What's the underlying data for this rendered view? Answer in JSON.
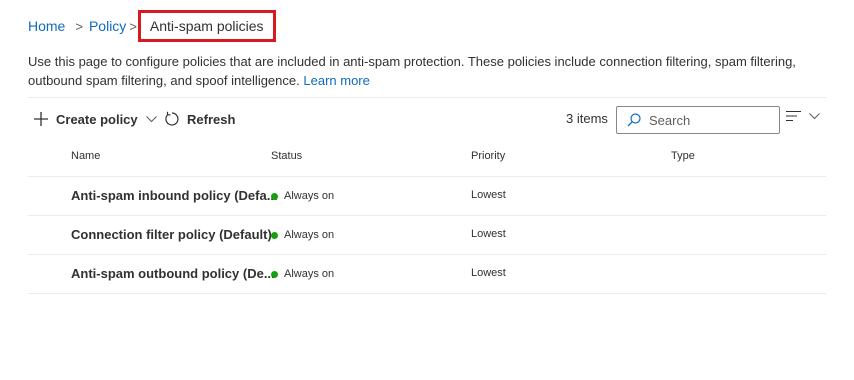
{
  "breadcrumb": {
    "home": "Home",
    "policy": "Policy",
    "current": "Anti-spam policies",
    "separator": ">"
  },
  "description": {
    "text": "Use this page to configure policies that are included in anti-spam protection. These policies include connection filtering, spam filtering, outbound spam filtering, and spoof intelligence.",
    "link": "Learn more"
  },
  "toolbar": {
    "create_label": "Create policy",
    "refresh_label": "Refresh",
    "items_count": "3 items",
    "search_placeholder": "Search"
  },
  "table": {
    "columns": {
      "name": "Name",
      "status": "Status",
      "priority": "Priority",
      "type": "Type"
    },
    "rows": [
      {
        "name": "Anti-spam inbound policy (Defa...",
        "status": "Always on",
        "priority": "Lowest",
        "type": ""
      },
      {
        "name": "Connection filter policy (Default)",
        "status": "Always on",
        "priority": "Lowest",
        "type": ""
      },
      {
        "name": "Anti-spam outbound policy (De...",
        "status": "Always on",
        "priority": "Lowest",
        "type": ""
      }
    ]
  },
  "colors": {
    "link": "#0f6cbd",
    "highlight_box": "#d71920",
    "status_on": "#13a10e"
  },
  "icons": {
    "add": "plus-icon",
    "create_menu": "chevron-down-icon",
    "refresh": "refresh-icon",
    "search": "search-icon",
    "filter": "filter-lines-icon",
    "filter_menu": "chevron-down-icon"
  }
}
